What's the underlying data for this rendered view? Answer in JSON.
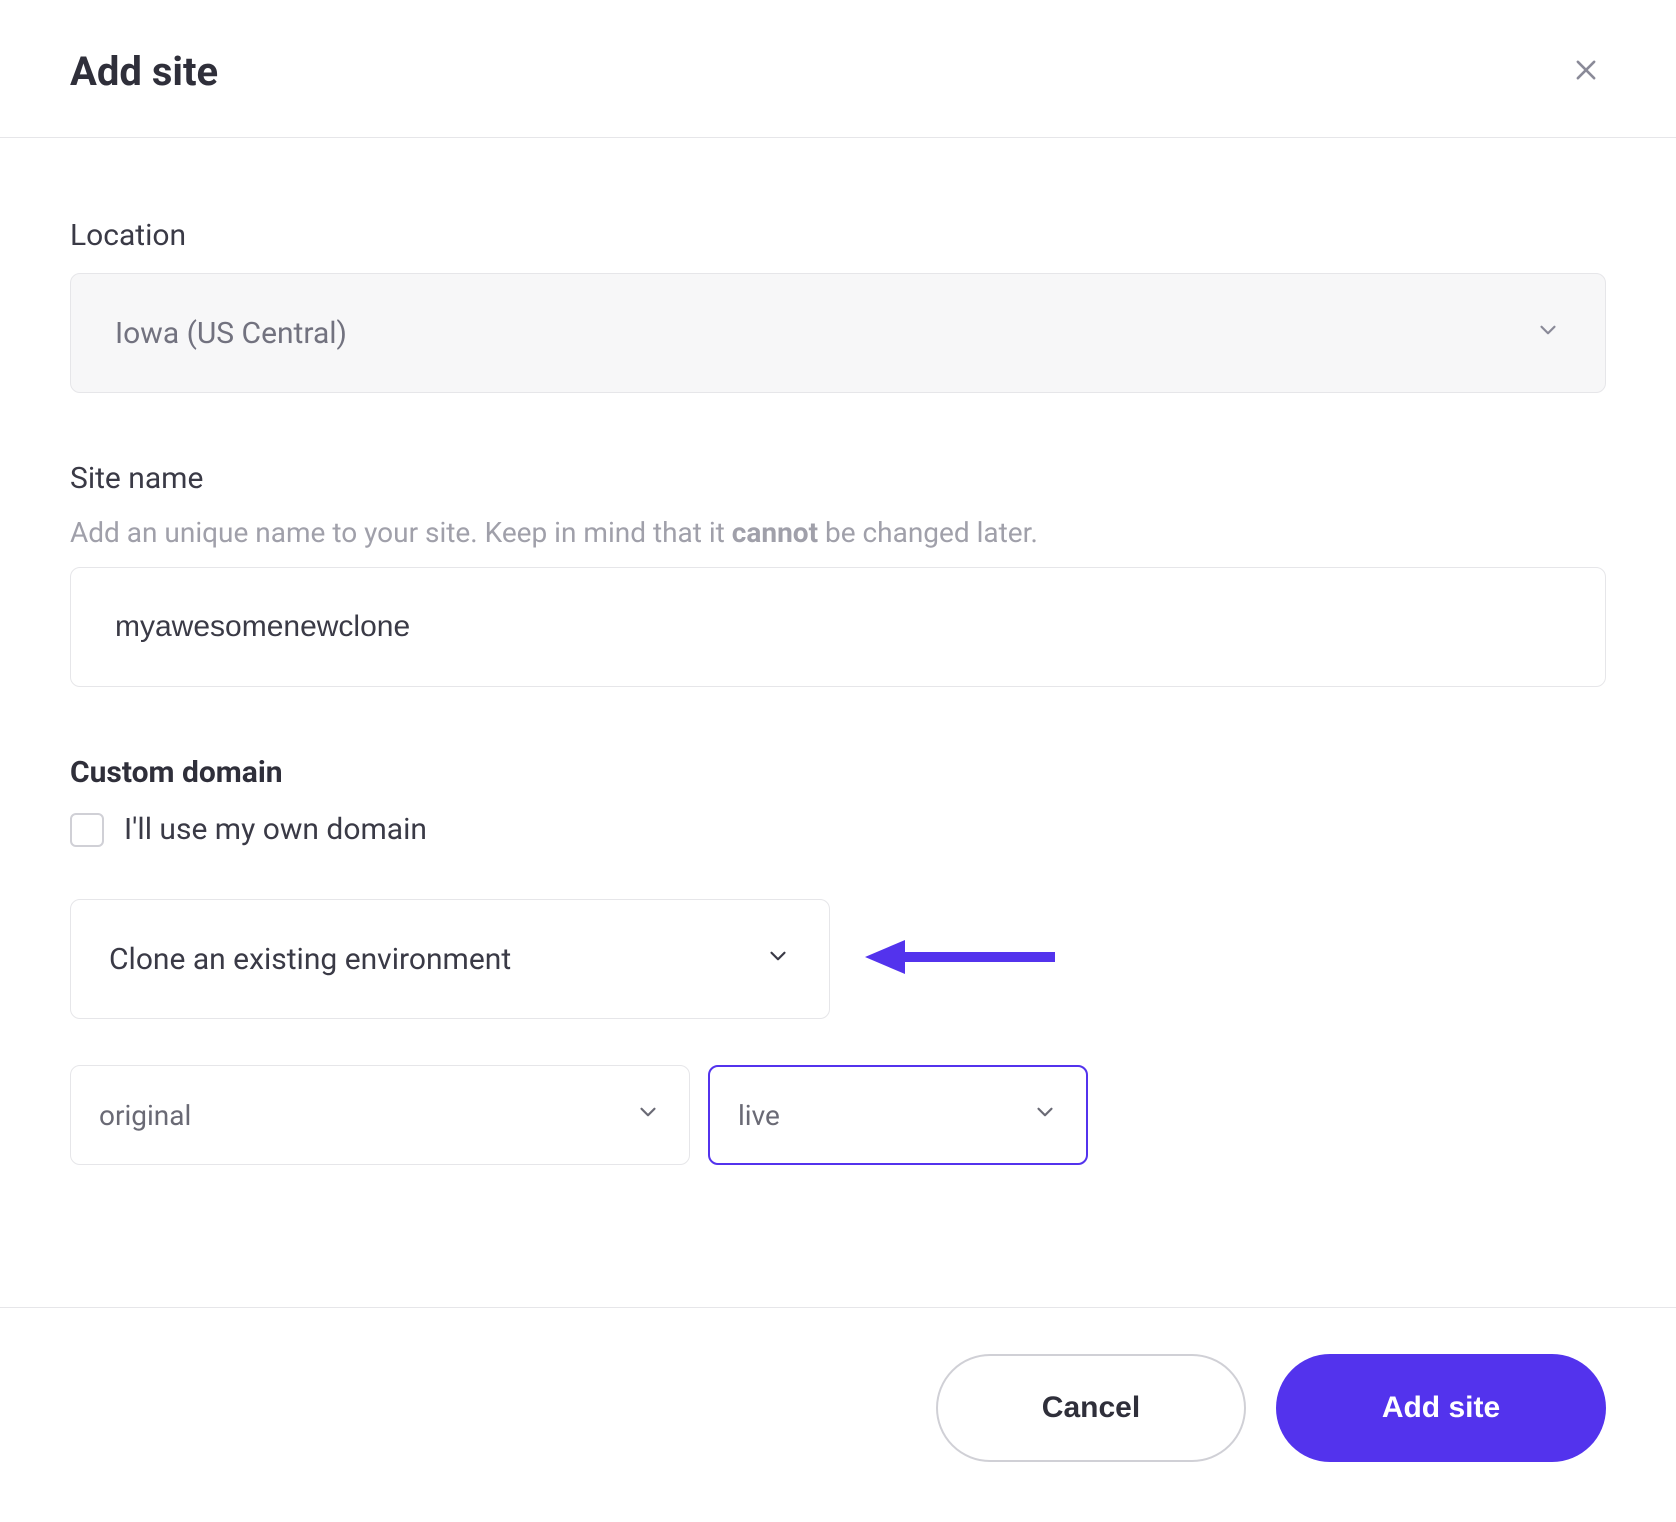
{
  "header": {
    "title": "Add site"
  },
  "location": {
    "label": "Location",
    "value": "Iowa (US Central)"
  },
  "siteName": {
    "label": "Site name",
    "help_pre": "Add an unique name to your site. Keep in mind that it ",
    "help_bold": "cannot",
    "help_post": " be changed later.",
    "value": "myawesomenewclone"
  },
  "customDomain": {
    "label": "Custom domain",
    "checkboxLabel": "I'll use my own domain"
  },
  "cloneSelect": {
    "value": "Clone an existing environment"
  },
  "siteSelect": {
    "value": "original"
  },
  "envSelect": {
    "value": "live"
  },
  "footer": {
    "cancel": "Cancel",
    "submit": "Add site"
  }
}
